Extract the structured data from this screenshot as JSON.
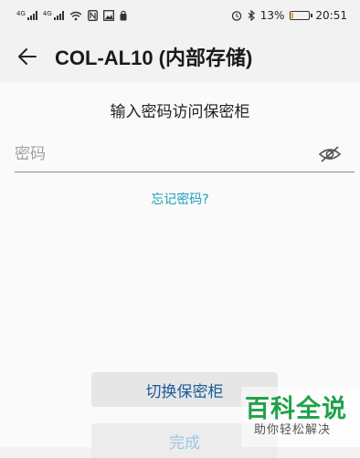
{
  "status_bar": {
    "signal1_label": "4G",
    "signal2_label": "4G",
    "battery_percent": "13%",
    "battery_level": 0.13,
    "battery_color": "#f39c12",
    "time": "20:51",
    "icons": [
      "signal-icon",
      "signal-icon",
      "wifi-icon",
      "nfc-icon",
      "image-icon",
      "lock-icon",
      "alarm-icon",
      "bluetooth-icon",
      "battery-icon"
    ]
  },
  "header": {
    "title": "COL-AL10 (内部存储)",
    "back_icon": "arrow-left-icon"
  },
  "form": {
    "prompt": "输入密码访问保密柜",
    "password_placeholder": "密码",
    "password_value": "",
    "visibility_icon": "eye-off-icon",
    "forgot_link": "忘记密码?",
    "link_color": "#1aa0b8"
  },
  "buttons": {
    "switch_label": "切换保密柜",
    "done_label": "完成"
  },
  "watermark": {
    "main": "百科全说",
    "sub": "助你轻松解决",
    "color": "#22a14a"
  }
}
